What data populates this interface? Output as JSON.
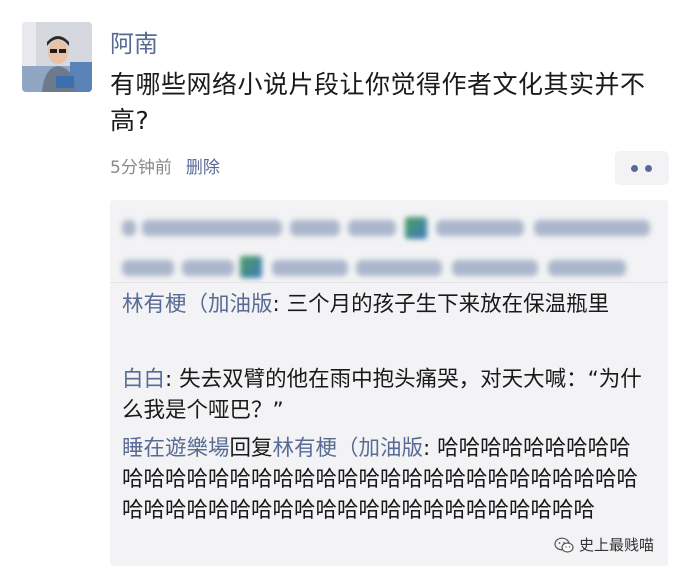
{
  "post": {
    "author": "阿南",
    "content": "有哪些网络小说片段让你觉得作者文化其实并不高?",
    "time": "5分钟前",
    "delete_label": "删除"
  },
  "comments": [
    {
      "name": "林有梗（加油版",
      "separator": ": ",
      "text": "三个月的孩子生下来放在保温瓶里"
    },
    {
      "name": "白白",
      "separator": ": ",
      "text": "失去双臂的他在雨中抱头痛哭，对天大喊：“为什么我是个哑巴？”"
    },
    {
      "name": "睡在遊樂場",
      "reply_word": "回复",
      "reply_to": "林有梗（加油版",
      "separator": ": ",
      "text": "哈哈哈哈哈哈哈哈哈哈哈哈哈哈哈哈哈哈哈哈哈哈哈哈哈哈哈哈哈哈哈哈哈哈哈哈哈哈哈哈哈哈哈哈哈哈哈哈哈哈哈哈哈哈哈"
    }
  ],
  "watermark": {
    "label": "史上最贱喵",
    "icon": "wechat-icon"
  },
  "colors": {
    "name_blue": "#576b95",
    "comment_bg": "#f3f3f5",
    "meta_gray": "#8a8a8a"
  }
}
